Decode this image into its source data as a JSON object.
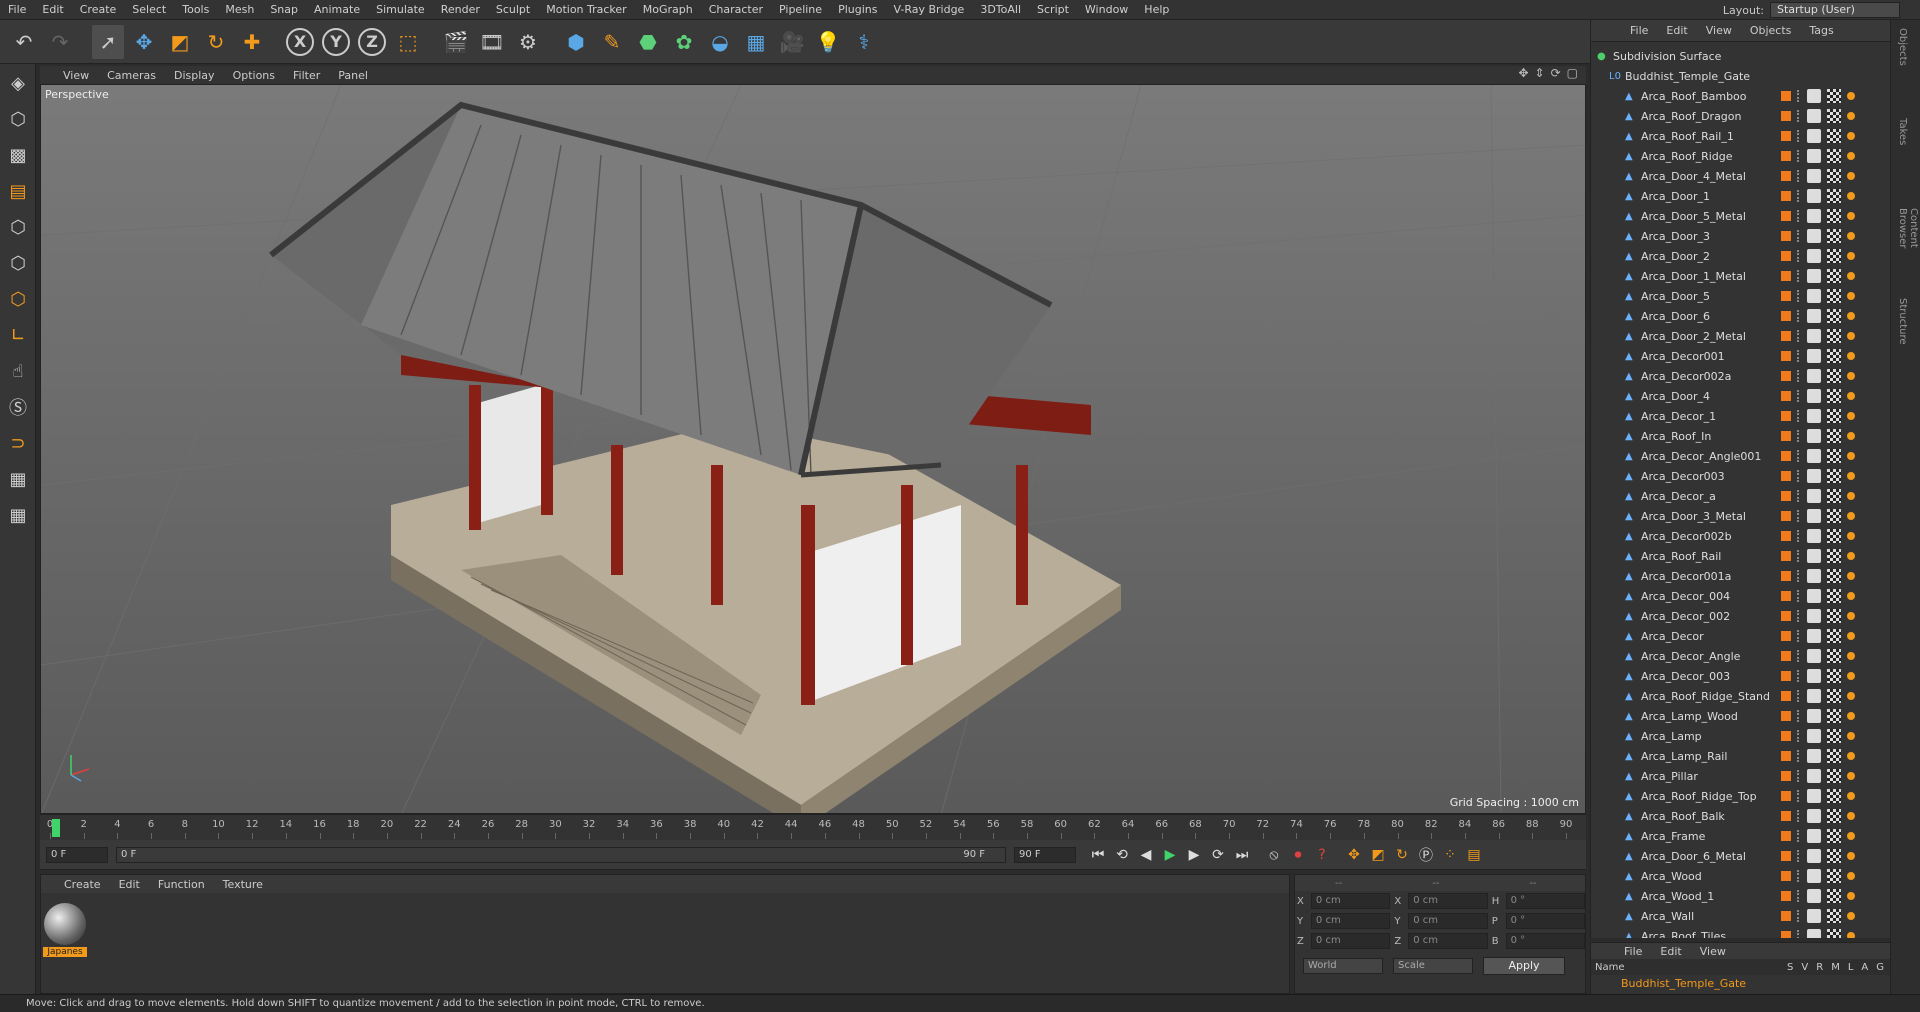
{
  "menubar": {
    "items": [
      "File",
      "Edit",
      "Create",
      "Select",
      "Tools",
      "Mesh",
      "Snap",
      "Animate",
      "Simulate",
      "Render",
      "Sculpt",
      "Motion Tracker",
      "MoGraph",
      "Character",
      "Pipeline",
      "Plugins",
      "V-Ray Bridge",
      "3DToAll",
      "Script",
      "Window",
      "Help"
    ],
    "layout_label": "Layout:",
    "layout_value": "Startup (User)"
  },
  "viewport": {
    "menu": [
      "View",
      "Cameras",
      "Display",
      "Options",
      "Filter",
      "Panel"
    ],
    "label": "Perspective",
    "grid_spacing": "Grid Spacing : 1000 cm"
  },
  "timeline": {
    "ticks": [
      "0",
      "2",
      "4",
      "6",
      "8",
      "10",
      "12",
      "14",
      "16",
      "18",
      "20",
      "22",
      "24",
      "26",
      "28",
      "30",
      "32",
      "34",
      "36",
      "38",
      "40",
      "42",
      "44",
      "46",
      "48",
      "50",
      "52",
      "54",
      "56",
      "58",
      "60",
      "62",
      "64",
      "66",
      "68",
      "70",
      "72",
      "74",
      "76",
      "78",
      "80",
      "82",
      "84",
      "86",
      "88",
      "90"
    ]
  },
  "transport": {
    "current_frame": "0 F",
    "range_start": "0 F",
    "range_end": "90 F",
    "max_frame": "90 F",
    "end_field": "0 F"
  },
  "material_panel": {
    "menu": [
      "Create",
      "Edit",
      "Function",
      "Texture"
    ],
    "material_name": "Japanes"
  },
  "coords": {
    "header_left": "--",
    "header_mid": "--",
    "header_right": "--",
    "rows": [
      {
        "a": "X",
        "av": "0 cm",
        "b": "X",
        "bv": "0 cm",
        "c": "H",
        "cv": "0 °"
      },
      {
        "a": "Y",
        "av": "0 cm",
        "b": "Y",
        "bv": "0 cm",
        "c": "P",
        "cv": "0 °"
      },
      {
        "a": "Z",
        "av": "0 cm",
        "b": "Z",
        "bv": "0 cm",
        "c": "B",
        "cv": "0 °"
      }
    ],
    "world": "World",
    "scale": "Scale",
    "apply": "Apply"
  },
  "objects": {
    "menu": [
      "File",
      "Edit",
      "View",
      "Objects",
      "Tags"
    ],
    "root": "Subdivision Surface",
    "group": "Buddhist_Temple_Gate",
    "items": [
      "Arca_Roof_Bamboo",
      "Arca_Roof_Dragon",
      "Arca_Roof_Rail_1",
      "Arca_Roof_Ridge",
      "Arca_Door_4_Metal",
      "Arca_Door_1",
      "Arca_Door_5_Metal",
      "Arca_Door_3",
      "Arca_Door_2",
      "Arca_Door_1_Metal",
      "Arca_Door_5",
      "Arca_Door_6",
      "Arca_Door_2_Metal",
      "Arca_Decor001",
      "Arca_Decor002a",
      "Arca_Door_4",
      "Arca_Decor_1",
      "Arca_Roof_In",
      "Arca_Decor_Angle001",
      "Arca_Decor003",
      "Arca_Decor_a",
      "Arca_Door_3_Metal",
      "Arca_Decor002b",
      "Arca_Roof_Rail",
      "Arca_Decor001a",
      "Arca_Decor_004",
      "Arca_Decor_002",
      "Arca_Decor",
      "Arca_Decor_Angle",
      "Arca_Decor_003",
      "Arca_Roof_Ridge_Stand",
      "Arca_Lamp_Wood",
      "Arca_Lamp",
      "Arca_Lamp_Rail",
      "Arca_Pillar",
      "Arca_Roof_Ridge_Top",
      "Arca_Roof_Balk",
      "Arca_Frame",
      "Arca_Door_6_Metal",
      "Arca_Wood",
      "Arca_Wood_1",
      "Arca_Wall",
      "Arca_Roof_Tiles"
    ]
  },
  "layers": {
    "menu": [
      "File",
      "Edit",
      "View"
    ],
    "name_col": "Name",
    "cols": [
      "S",
      "V",
      "R",
      "M",
      "L",
      "A",
      "G"
    ],
    "row": "Buddhist_Temple_Gate"
  },
  "sidetabs": [
    "Objects",
    "Takes",
    "Content Browser",
    "Structure"
  ],
  "status": "Move: Click and drag to move elements. Hold down SHIFT to quantize movement / add to the selection in point mode, CTRL to remove."
}
